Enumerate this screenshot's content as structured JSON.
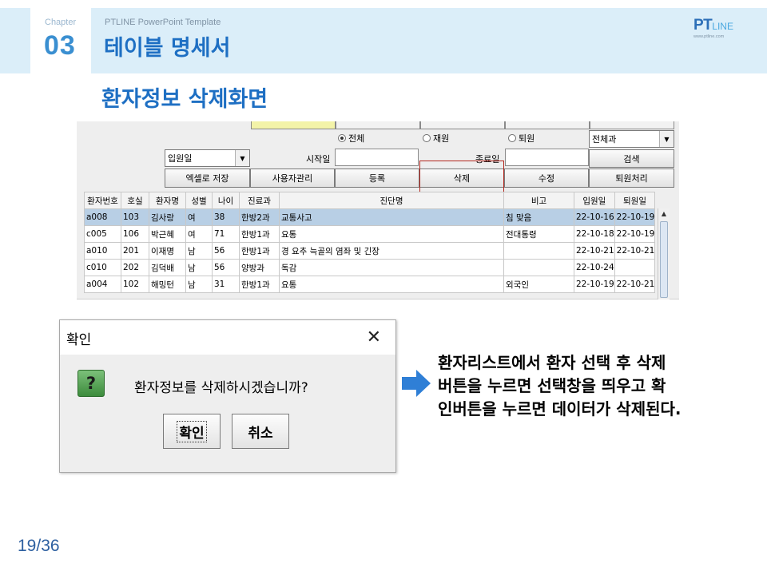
{
  "header": {
    "chapter_label": "Chapter",
    "chapter_number": "03",
    "template_label": "PTLINE PowerPoint Template",
    "title": "테이블 명세서",
    "logo_main": "PT",
    "logo_line": "LINE",
    "logo_sub": "www.ptline.com"
  },
  "section_title": "환자정보 삭제화면",
  "app": {
    "radios": [
      {
        "label": "전체",
        "selected": true
      },
      {
        "label": "재원",
        "selected": false
      },
      {
        "label": "퇴원",
        "selected": false
      }
    ],
    "dept_combo": "전체과",
    "date_combo": "입원일",
    "start_label": "시작일",
    "end_label": "종료일",
    "search_button": "검색",
    "buttons": [
      "엑셀로 저장",
      "사용자관리",
      "등록",
      "삭제",
      "수정",
      "퇴원처리"
    ],
    "table": {
      "columns": [
        "환자번호",
        "호실",
        "환자명",
        "성별",
        "나이",
        "진료과",
        "진단명",
        "비고",
        "입원일",
        "퇴원일"
      ],
      "rows": [
        [
          "a008",
          "103",
          "김사랑",
          "여",
          "38",
          "한방2과",
          "교통사고",
          "침 맞음",
          "22-10-16",
          "22-10-19"
        ],
        [
          "c005",
          "106",
          "박근혜",
          "여",
          "71",
          "한방1과",
          "요통",
          "전대통령",
          "22-10-18",
          "22-10-19"
        ],
        [
          "a010",
          "201",
          "이재명",
          "남",
          "56",
          "한방1과",
          "경 요추 늑골의 염좌 및 긴장",
          "",
          "22-10-21",
          "22-10-21"
        ],
        [
          "c010",
          "202",
          "김덕배",
          "남",
          "56",
          "양방과",
          "독감",
          "",
          "22-10-24",
          ""
        ],
        [
          "a004",
          "102",
          "해밍턴",
          "남",
          "31",
          "한방1과",
          "요통",
          "외국인",
          "22-10-19",
          "22-10-21"
        ]
      ]
    }
  },
  "dialog": {
    "title": "확인",
    "message": "환자정보를 삭제하시겠습니까?",
    "ok": "확인",
    "cancel": "취소"
  },
  "description": {
    "lines": [
      "환자리스트에서 환자 선택 후 삭제",
      "버튼을 누르면 선택창을 띄우고 확",
      "인버튼을 누르면 데이터가 삭제된다."
    ]
  },
  "page_number": "19/36",
  "colors": {
    "accent": "#1e6fc3",
    "header_band": "#dbeef9",
    "selected_row": "#b8cfe5",
    "highlight_box": "#b3261e",
    "arrow": "#2f7fd6"
  }
}
